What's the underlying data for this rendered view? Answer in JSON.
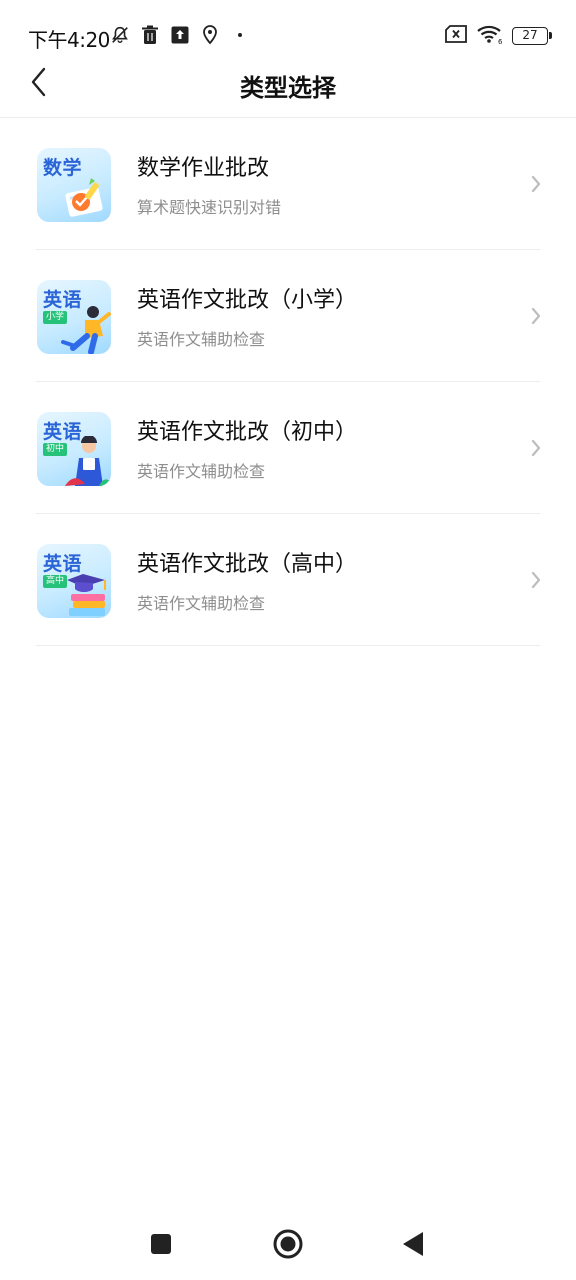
{
  "status_bar": {
    "time": "下午4:20",
    "battery": "27",
    "icons_left": [
      "bell-muted-icon",
      "trash-icon",
      "upload-icon",
      "location-icon",
      "dot-icon"
    ],
    "icons_right": [
      "sim-x-icon",
      "wifi-icon",
      "battery-icon"
    ],
    "wifi_label": "6"
  },
  "header": {
    "title": "类型选择",
    "back_icon": "chevron-left-icon"
  },
  "items": [
    {
      "title": "数学作业批改",
      "subtitle": "算术题快速识别对错",
      "thumb_word": "数学",
      "thumb_tag": ""
    },
    {
      "title": "英语作文批改（小学）",
      "subtitle": "英语作文辅助检查",
      "thumb_word": "英语",
      "thumb_tag": "小学"
    },
    {
      "title": "英语作文批改（初中）",
      "subtitle": "英语作文辅助检查",
      "thumb_word": "英语",
      "thumb_tag": "初中"
    },
    {
      "title": "英语作文批改（高中）",
      "subtitle": "英语作文辅助检查",
      "thumb_word": "英语",
      "thumb_tag": "高中"
    }
  ],
  "nav_bar": {
    "icons": [
      "recent-apps-icon",
      "home-icon",
      "back-icon"
    ]
  },
  "colors": {
    "accent_blue": "#2a64d6",
    "tag_green": "#27c27a",
    "subtitle_gray": "#8e8e8e"
  }
}
